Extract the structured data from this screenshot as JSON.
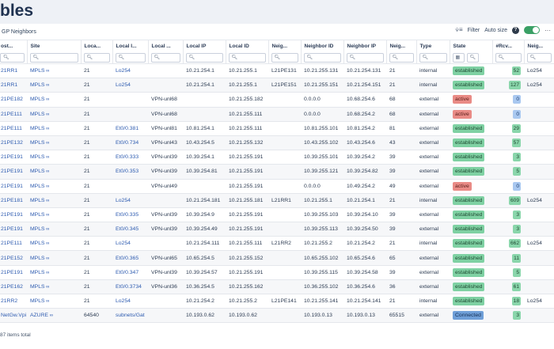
{
  "page": {
    "title": "bles"
  },
  "toolbar": {
    "title": "GP Neighbors",
    "filter_label": "Filter",
    "autosize_label": "Auto size",
    "help_label": "?",
    "more_label": "···"
  },
  "columns": [
    "ost...",
    "Site",
    "Loca...",
    "Local I...",
    "Local ...",
    "Local IP",
    "Local ID",
    "Neig...",
    "Neighbor ID",
    "Neighbor IP",
    "Neig...",
    "Type",
    "State",
    "#Rcv...",
    "Neig..."
  ],
  "rows": [
    [
      "21RR1",
      "MPLS",
      "21",
      "Lo254",
      "",
      "10.21.254.1",
      "10.21.255.1",
      "L21PE131",
      "10.21.255.131",
      "10.21.254.131",
      "21",
      "internal",
      "established",
      "52",
      "Lo254"
    ],
    [
      "21RR1",
      "MPLS",
      "21",
      "Lo254",
      "",
      "10.21.254.1",
      "10.21.255.1",
      "L21PE151",
      "10.21.255.151",
      "10.21.254.151",
      "21",
      "internal",
      "established",
      "127",
      "Lo254"
    ],
    [
      "21PE182",
      "MPLS",
      "21",
      "",
      "VPN-unl68",
      "",
      "10.21.255.182",
      "",
      "0.0.0.0",
      "10.68.254.6",
      "68",
      "external",
      "active",
      "0",
      ""
    ],
    [
      "21PE111",
      "MPLS",
      "21",
      "",
      "VPN-unl68",
      "",
      "10.21.255.111",
      "",
      "0.0.0.0",
      "10.68.254.2",
      "68",
      "external",
      "active",
      "0",
      ""
    ],
    [
      "21PE111",
      "MPLS",
      "21",
      "Et0/0.381",
      "VPN-unl81",
      "10.81.254.1",
      "10.21.255.111",
      "",
      "10.81.255.101",
      "10.81.254.2",
      "81",
      "external",
      "established",
      "29",
      ""
    ],
    [
      "21PE132",
      "MPLS",
      "21",
      "Et0/0.734",
      "VPN-unl43",
      "10.43.254.5",
      "10.21.255.132",
      "",
      "10.43.255.102",
      "10.43.254.6",
      "43",
      "external",
      "established",
      "57",
      ""
    ],
    [
      "21PE191",
      "MPLS",
      "21",
      "Et0/0.333",
      "VPN-unl39",
      "10.39.254.1",
      "10.21.255.191",
      "",
      "10.39.255.101",
      "10.39.254.2",
      "39",
      "external",
      "established",
      "3",
      ""
    ],
    [
      "21PE191",
      "MPLS",
      "21",
      "Et0/0.353",
      "VPN-unl39",
      "10.39.254.81",
      "10.21.255.191",
      "",
      "10.39.255.121",
      "10.39.254.82",
      "39",
      "external",
      "established",
      "5",
      ""
    ],
    [
      "21PE191",
      "MPLS",
      "21",
      "",
      "VPN-unl49",
      "",
      "10.21.255.191",
      "",
      "0.0.0.0",
      "10.49.254.2",
      "49",
      "external",
      "active",
      "0",
      ""
    ],
    [
      "21PE181",
      "MPLS",
      "21",
      "Lo254",
      "",
      "10.21.254.181",
      "10.21.255.181",
      "L21RR1",
      "10.21.255.1",
      "10.21.254.1",
      "21",
      "internal",
      "established",
      "609",
      "Lo254"
    ],
    [
      "21PE191",
      "MPLS",
      "21",
      "Et0/0.335",
      "VPN-unl39",
      "10.39.254.9",
      "10.21.255.191",
      "",
      "10.39.255.103",
      "10.39.254.10",
      "39",
      "external",
      "established",
      "3",
      ""
    ],
    [
      "21PE191",
      "MPLS",
      "21",
      "Et0/0.345",
      "VPN-unl39",
      "10.39.254.49",
      "10.21.255.191",
      "",
      "10.39.255.113",
      "10.39.254.50",
      "39",
      "external",
      "established",
      "3",
      ""
    ],
    [
      "21PE111",
      "MPLS",
      "21",
      "Lo254",
      "",
      "10.21.254.111",
      "10.21.255.111",
      "L21RR2",
      "10.21.255.2",
      "10.21.254.2",
      "21",
      "internal",
      "established",
      "662",
      "Lo254"
    ],
    [
      "21PE152",
      "MPLS",
      "21",
      "Et0/0.365",
      "VPN-unl65",
      "10.65.254.5",
      "10.21.255.152",
      "",
      "10.65.255.102",
      "10.65.254.6",
      "65",
      "external",
      "established",
      "11",
      ""
    ],
    [
      "21PE191",
      "MPLS",
      "21",
      "Et0/0.347",
      "VPN-unl39",
      "10.39.254.57",
      "10.21.255.191",
      "",
      "10.39.255.115",
      "10.39.254.58",
      "39",
      "external",
      "established",
      "5",
      ""
    ],
    [
      "21PE162",
      "MPLS",
      "21",
      "Et0/0.3734",
      "VPN-unl36",
      "10.36.254.5",
      "10.21.255.162",
      "",
      "10.36.255.102",
      "10.36.254.6",
      "36",
      "external",
      "established",
      "61",
      ""
    ],
    [
      "21RR2",
      "MPLS",
      "21",
      "Lo254",
      "",
      "10.21.254.2",
      "10.21.255.2",
      "L21PE141",
      "10.21.255.141",
      "10.21.254.141",
      "21",
      "internal",
      "established",
      "18",
      "Lo254"
    ],
    [
      "NetGw.Vpi",
      "AZURE",
      "64540",
      "subnets/Gat",
      "",
      "10.193.0.62",
      "10.193.0.62",
      "",
      "10.193.0.13",
      "10.193.0.13",
      "65515",
      "external",
      "Connected",
      "3",
      ""
    ]
  ],
  "footer": {
    "total": "87 items total"
  },
  "colors": {
    "established": "#7fd1a3",
    "active": "#e98b86",
    "connected": "#6f9fd8",
    "toggle": "#3aa065"
  }
}
